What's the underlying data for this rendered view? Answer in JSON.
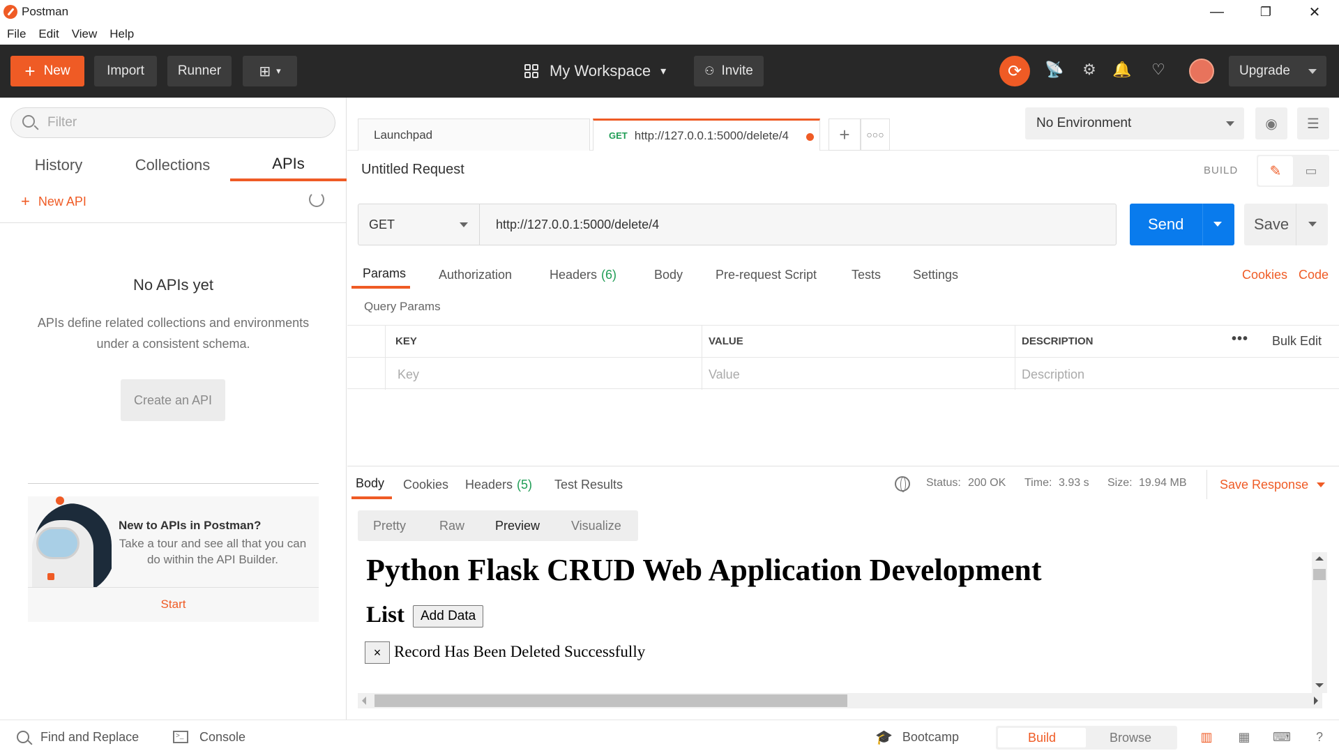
{
  "window": {
    "title": "Postman",
    "minimize": "—",
    "restore": "❐",
    "close": "✕"
  },
  "menu": [
    "File",
    "Edit",
    "View",
    "Help"
  ],
  "header": {
    "new_label": "New",
    "import_label": "Import",
    "runner_label": "Runner",
    "workspace_label": "My Workspace",
    "invite_label": "Invite",
    "upgrade_label": "Upgrade"
  },
  "sidebar": {
    "filter_placeholder": "Filter",
    "tabs": [
      "History",
      "Collections",
      "APIs"
    ],
    "active_tab": "APIs",
    "new_api_label": "New API",
    "empty_title": "No APIs yet",
    "empty_desc": "APIs define related collections and environments under a consistent schema.",
    "create_label": "Create an API",
    "tour": {
      "title": "New to APIs in Postman?",
      "desc": "Take a tour and see all that you can do within the API Builder.",
      "start_label": "Start"
    }
  },
  "tabs": {
    "launchpad_label": "Launchpad",
    "request_method": "GET",
    "request_url": "http://127.0.0.1:5000/delete/4"
  },
  "environment": {
    "selected": "No Environment"
  },
  "request": {
    "title": "Untitled Request",
    "build_label": "BUILD",
    "method": "GET",
    "url": "http://127.0.0.1:5000/delete/4",
    "send_label": "Send",
    "save_label": "Save",
    "tabs": {
      "params": "Params",
      "authorization": "Authorization",
      "headers": "Headers",
      "headers_count": "(6)",
      "body": "Body",
      "prerequest": "Pre-request Script",
      "tests": "Tests",
      "settings": "Settings"
    },
    "cookies_label": "Cookies",
    "code_label": "Code",
    "query_params_label": "Query Params",
    "table": {
      "col_key": "KEY",
      "col_value": "VALUE",
      "col_description": "DESCRIPTION",
      "bulk_edit": "Bulk Edit",
      "ph_key": "Key",
      "ph_value": "Value",
      "ph_description": "Description"
    }
  },
  "response": {
    "tabs": {
      "body": "Body",
      "cookies": "Cookies",
      "headers": "Headers",
      "headers_count": "(5)",
      "test_results": "Test Results"
    },
    "status_label": "Status:",
    "status_value": "200 OK",
    "time_label": "Time:",
    "time_value": "3.93 s",
    "size_label": "Size:",
    "size_value": "19.94 MB",
    "save_response_label": "Save Response",
    "view_modes": [
      "Pretty",
      "Raw",
      "Preview",
      "Visualize"
    ],
    "active_view": "Preview",
    "preview": {
      "heading": "Python Flask CRUD Web Application Development",
      "list_heading": "List",
      "add_button": "Add Data",
      "close_button": "×",
      "message": "Record Has Been Deleted Successfully"
    }
  },
  "footer": {
    "find_replace_label": "Find and Replace",
    "console_label": "Console",
    "bootcamp_label": "Bootcamp",
    "build_label": "Build",
    "browse_label": "Browse"
  },
  "colors": {
    "accent": "#ef5b25",
    "header_bg": "#282828",
    "send_blue": "#097bed",
    "status_green": "#1f9d55"
  }
}
